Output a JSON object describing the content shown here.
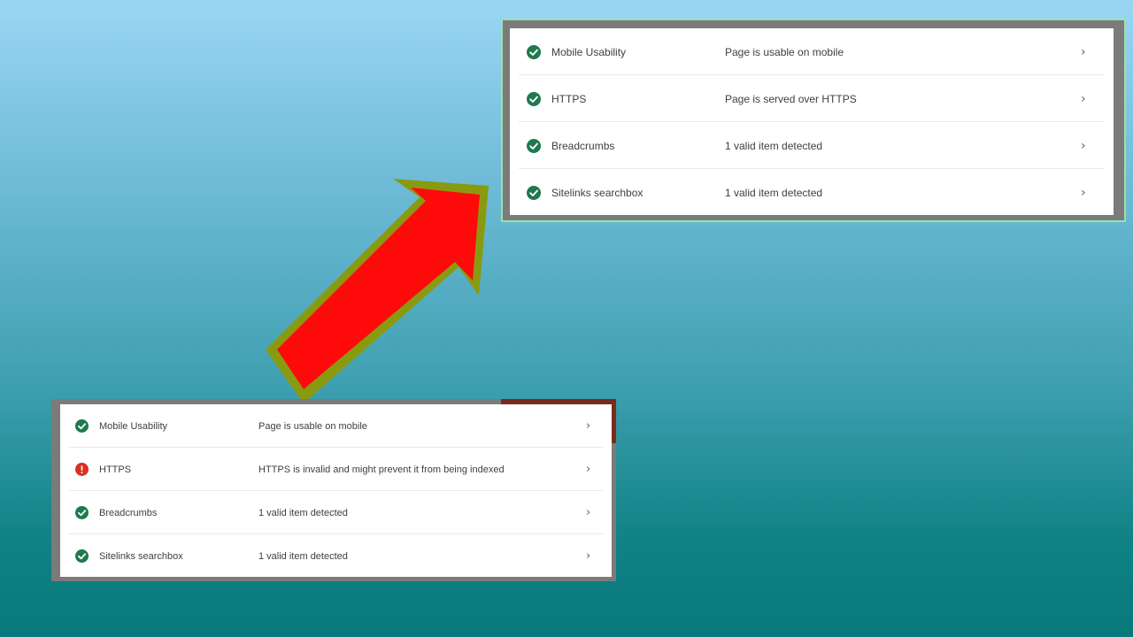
{
  "colors": {
    "ok": "#1e7a4e",
    "error": "#d93025",
    "arrow_fill": "#ff0a0a",
    "arrow_border": "#8a9a10"
  },
  "after_panel": {
    "rows": [
      {
        "status": "ok",
        "icon": "check-circle-icon",
        "label": "Mobile Usability",
        "description": "Page is usable on mobile",
        "chevron": "›"
      },
      {
        "status": "ok",
        "icon": "check-circle-icon",
        "label": "HTTPS",
        "description": "Page is served over HTTPS",
        "chevron": "›"
      },
      {
        "status": "ok",
        "icon": "check-circle-icon",
        "label": "Breadcrumbs",
        "description": "1 valid item detected",
        "chevron": "›"
      },
      {
        "status": "ok",
        "icon": "check-circle-icon",
        "label": "Sitelinks searchbox",
        "description": "1 valid item detected",
        "chevron": "›"
      }
    ]
  },
  "before_panel": {
    "rows": [
      {
        "status": "ok",
        "icon": "check-circle-icon",
        "label": "Mobile Usability",
        "description": "Page is usable on mobile",
        "chevron": "›"
      },
      {
        "status": "error",
        "icon": "error-circle-icon",
        "label": "HTTPS",
        "description": "HTTPS is invalid and might prevent it from being indexed",
        "chevron": "›"
      },
      {
        "status": "ok",
        "icon": "check-circle-icon",
        "label": "Breadcrumbs",
        "description": "1 valid item detected",
        "chevron": "›"
      },
      {
        "status": "ok",
        "icon": "check-circle-icon",
        "label": "Sitelinks searchbox",
        "description": "1 valid item detected",
        "chevron": "›"
      }
    ]
  }
}
